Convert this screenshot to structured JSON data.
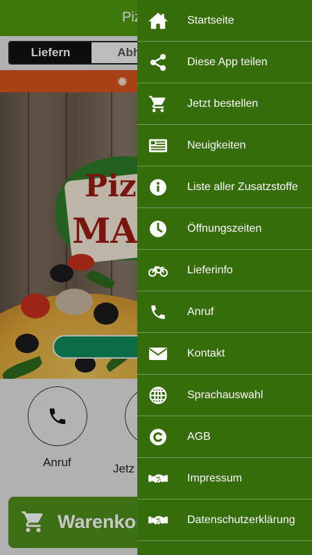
{
  "app": {
    "title": "Piz",
    "tabs": [
      {
        "label": "Liefern",
        "active": true
      },
      {
        "label": "Abho",
        "active": false
      }
    ],
    "logo": {
      "line1": "Pizz",
      "line2": "MAN"
    },
    "quick_actions": [
      {
        "label": "Anruf",
        "icon": "phone-icon"
      },
      {
        "label": "Jetz",
        "icon": "cart-icon"
      }
    ],
    "cart": {
      "label": "Warenkorl",
      "icon": "cart-icon"
    }
  },
  "drawer": {
    "items": [
      {
        "label": "Startseite",
        "icon": "home-icon"
      },
      {
        "label": "Diese App teilen",
        "icon": "share-icon"
      },
      {
        "label": "Jetzt bestellen",
        "icon": "cart-icon"
      },
      {
        "label": "Neuigkeiten",
        "icon": "newspaper-icon"
      },
      {
        "label": "Liste aller Zusatzstoffe",
        "icon": "info-icon"
      },
      {
        "label": "Öffnungszeiten",
        "icon": "clock-icon"
      },
      {
        "label": "Lieferinfo",
        "icon": "motorcycle-icon"
      },
      {
        "label": "Anruf",
        "icon": "phone-icon"
      },
      {
        "label": "Kontakt",
        "icon": "envelope-icon"
      },
      {
        "label": "Sprachauswahl",
        "icon": "globe-icon"
      },
      {
        "label": "AGB",
        "icon": "copyright-icon"
      },
      {
        "label": "Impressum",
        "icon": "handshake-icon"
      },
      {
        "label": "Datenschutzerklärung",
        "icon": "handshake-icon"
      }
    ]
  },
  "colors": {
    "topbar": "#4f9a10",
    "drawer": "#356d0b",
    "notice": "#d8541c",
    "cart_bar": "#4f8f1c"
  }
}
